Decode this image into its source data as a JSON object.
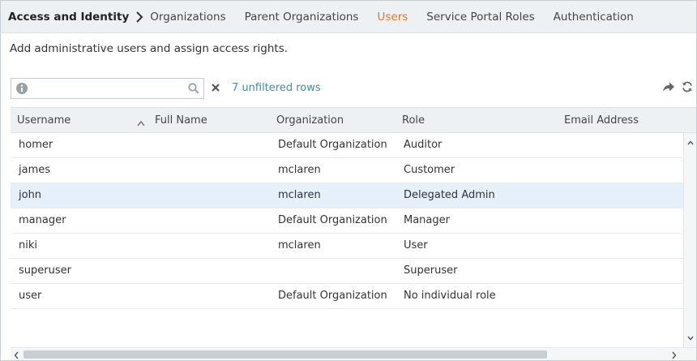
{
  "nav": {
    "title": "Access and Identity",
    "tabs": [
      {
        "label": "Organizations"
      },
      {
        "label": "Parent Organizations"
      },
      {
        "label": "Users",
        "active": true
      },
      {
        "label": "Service Portal Roles"
      },
      {
        "label": "Authentication"
      }
    ]
  },
  "description": "Add administrative users and assign access rights.",
  "toolbar": {
    "search_value": "",
    "search_placeholder": "",
    "row_count": "7 unfiltered rows"
  },
  "table": {
    "columns": [
      "Username",
      "Full Name",
      "Organization",
      "Role",
      "Email Address"
    ],
    "sort_column": "Username",
    "sort_direction": "ascending",
    "rows": [
      {
        "username": "homer",
        "full_name": "",
        "organization": "Default Organization",
        "role": "Auditor",
        "email": ""
      },
      {
        "username": "james",
        "full_name": "",
        "organization": "mclaren",
        "role": "Customer",
        "email": ""
      },
      {
        "username": "john",
        "full_name": "",
        "organization": "mclaren",
        "role": "Delegated Admin",
        "email": "",
        "selected": true
      },
      {
        "username": "manager",
        "full_name": "",
        "organization": "Default Organization",
        "role": "Manager",
        "email": ""
      },
      {
        "username": "niki",
        "full_name": "",
        "organization": "mclaren",
        "role": "User",
        "email": ""
      },
      {
        "username": "superuser",
        "full_name": "",
        "organization": "",
        "role": "Superuser",
        "email": ""
      },
      {
        "username": "user",
        "full_name": "",
        "organization": "Default Organization",
        "role": "No individual role",
        "email": ""
      }
    ]
  },
  "colors": {
    "accent": "#e8782e",
    "link": "#3f8ea6",
    "header_bg": "#eef1f4",
    "selected_row": "#e5f0fa"
  },
  "icons": [
    "chevron-right-icon",
    "info-icon",
    "search-icon",
    "clear-icon",
    "share-icon",
    "refresh-icon",
    "sort-ascending-icon",
    "scroll-up-arrow-icon",
    "scroll-down-arrow-icon",
    "scroll-left-arrow-icon",
    "scroll-right-arrow-icon"
  ]
}
